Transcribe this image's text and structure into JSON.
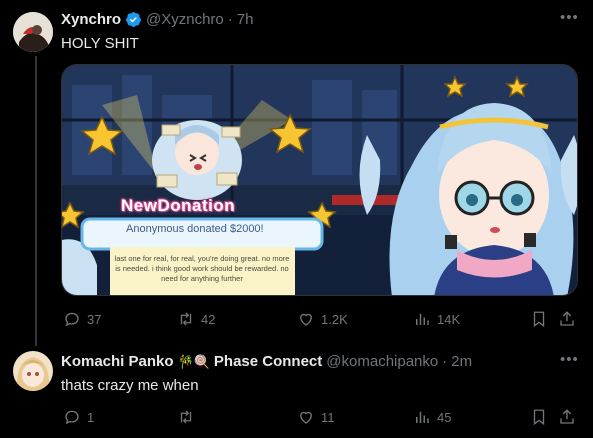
{
  "tweet": {
    "author_name": "Xynchro",
    "handle": "@Xyznchro",
    "separator": "·",
    "time": "7h",
    "text": "HOLY SHIT",
    "media": {
      "banner_title": "NewDonation",
      "donation_text": "Anonymous donated $2000!",
      "message": "last one for real, for real, you're doing great. no more is needed. i think good work should be rewarded. no need for anything further"
    },
    "actions": {
      "replies": "37",
      "retweets": "42",
      "likes": "1.2K",
      "views": "14K"
    }
  },
  "reply": {
    "author_name": "Komachi Panko",
    "author_emojis": "🎋🍭",
    "affiliation": "Phase Connect",
    "handle": "@komachipanko",
    "separator": "·",
    "time": "2m",
    "text": "thats crazy me when",
    "actions": {
      "replies": "1",
      "retweets": "",
      "likes": "11",
      "views": "45"
    }
  },
  "colors": {
    "background": "#000000",
    "text": "#e7e9ea",
    "muted": "#71767b",
    "verified": "#1d9bf0"
  }
}
